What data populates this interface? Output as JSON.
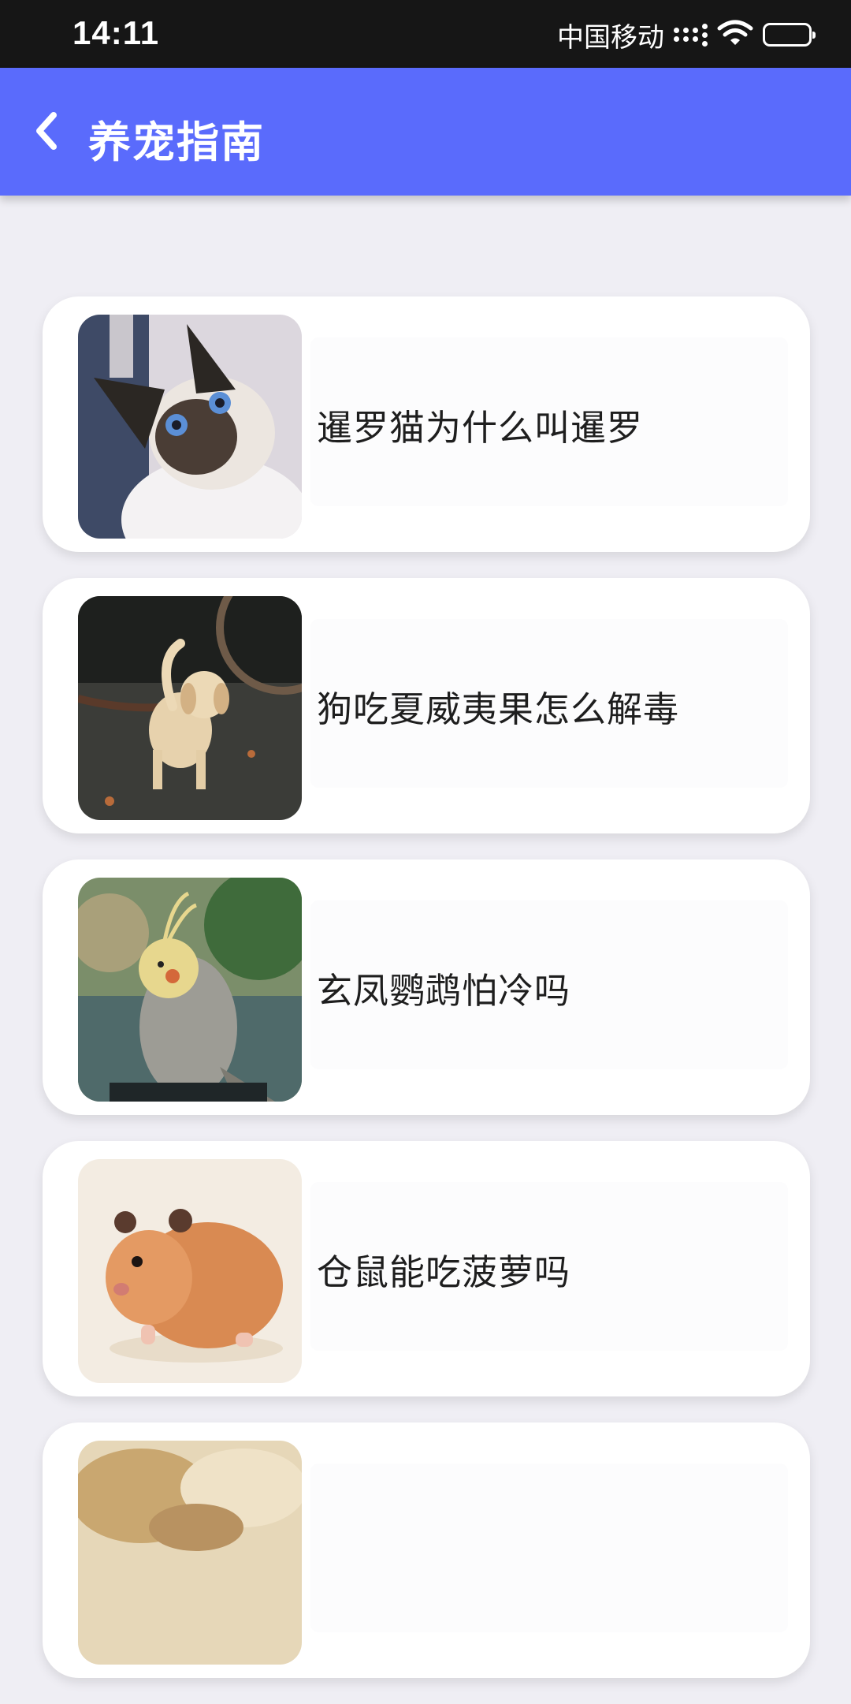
{
  "status_bar": {
    "time": "14:11",
    "carrier": "中国移动",
    "icons": [
      "signal-icon",
      "wifi-icon",
      "battery-icon"
    ]
  },
  "header": {
    "title": "养宠指南",
    "back_icon": "chevron-left-icon",
    "background": "#5a6bfc"
  },
  "articles": [
    {
      "title": "暹罗猫为什么叫暹罗",
      "image": "siamese-cat-photo"
    },
    {
      "title": "狗吃夏威夷果怎么解毒",
      "image": "puppy-photo"
    },
    {
      "title": "玄凤鹦鹉怕冷吗",
      "image": "cockatiel-photo"
    },
    {
      "title": "仓鼠能吃菠萝吗",
      "image": "hamster-photo"
    },
    {
      "title": "",
      "image": "sleeping-pet-photo"
    }
  ]
}
